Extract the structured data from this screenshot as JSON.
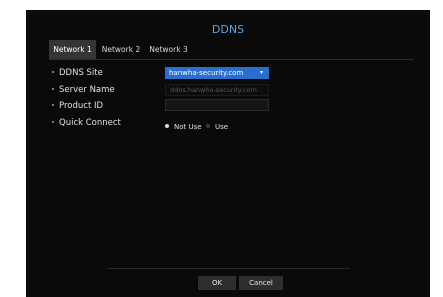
{
  "dialog": {
    "title": "DDNS",
    "tabs": [
      "Network 1",
      "Network 2",
      "Network 3"
    ],
    "active_tab": "Network 1"
  },
  "fields": {
    "ddns_site": {
      "label": "DDNS Site",
      "value": "hanwha-security.com"
    },
    "server_name": {
      "label": "Server Name",
      "placeholder": "ddns.hanwha-security.com"
    },
    "product_id": {
      "label": "Product ID",
      "value": ""
    },
    "quick_connect": {
      "label": "Quick Connect",
      "options": [
        "Not Use",
        "Use"
      ],
      "selected": "Not Use"
    }
  },
  "buttons": {
    "ok": "OK",
    "cancel": "Cancel"
  },
  "colors": {
    "accent": "#5aa6e8",
    "select_bg": "#2a6fcf",
    "dialog_bg": "#0a0a0a"
  },
  "icons": {
    "dropdown": "chevron-down-icon",
    "radio": "radio-dot-icon"
  }
}
